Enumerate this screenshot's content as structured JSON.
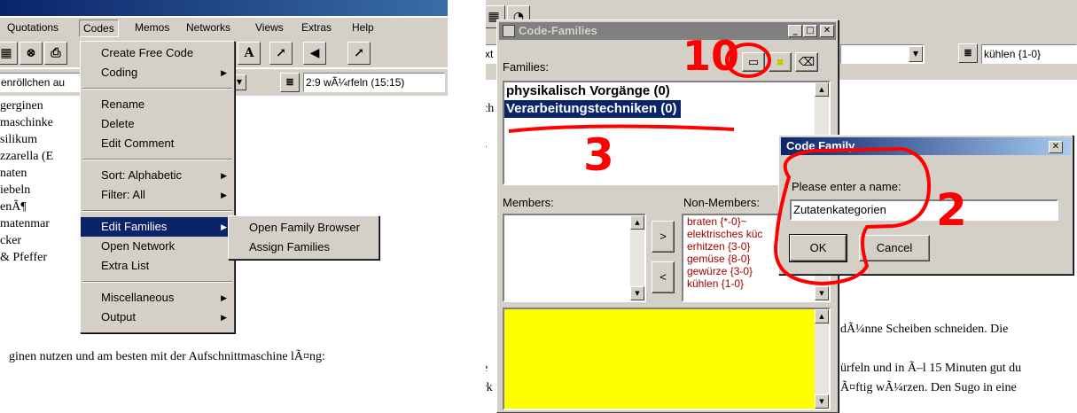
{
  "left_window": {
    "menubar": [
      "Quotations",
      "Codes",
      "Memos",
      "Networks",
      "Views",
      "Extras",
      "Help"
    ],
    "quotation_combo": "2:9 wÃ¼rfeln (15:15)",
    "doc_combo": "enröllchen au",
    "document_lines": [
      "gerginen",
      "maschinke",
      "silikum",
      "zzarella (E",
      "naten",
      "iebeln",
      "enÃ¶",
      "matenmar",
      "cker",
      "& Pfeffer"
    ],
    "document_bottom": "ginen nutzen und am besten mit der Aufschnittmaschine lÃ¤ng:",
    "codes_menu": {
      "items": [
        {
          "label": "Create Free Code"
        },
        {
          "label": "Coding",
          "submenu": true
        },
        {
          "label": "Rename"
        },
        {
          "label": "Delete"
        },
        {
          "label": "Edit Comment"
        },
        {
          "label": "Sort: Alphabetic",
          "submenu": true
        },
        {
          "label": "Filter: All",
          "submenu": true
        },
        {
          "label": "Edit Families",
          "submenu": true,
          "highlighted": true
        },
        {
          "label": "Open Network"
        },
        {
          "label": "Extra List"
        },
        {
          "label": "Miscellaneous",
          "submenu": true
        },
        {
          "label": "Output",
          "submenu": true
        }
      ]
    },
    "families_submenu": {
      "items": [
        "Open Family Browser",
        "Assign Families"
      ]
    }
  },
  "right_window": {
    "code_combo": "kühlen {1-0}",
    "doc_fragments": {
      "line1": "dÃ¼nne Scheiben schneiden. Die",
      "line2": "ürfeln und in Ã–l 15 Minuten gut du",
      "line3": "Ã¤ftig wÃ¼rzen. Den Sugo in eine",
      "frag_ch": "ch",
      "frag_r": "r",
      "frag_t": "t",
      "frag_e": "e",
      "frag_rk": "rk"
    },
    "code_families_dialog": {
      "title": "Code-Families",
      "families_label": "Families:",
      "families": [
        {
          "label": "physikalisch Vorgänge (0)",
          "selected": false
        },
        {
          "label": "Verarbeitungstechniken (0)",
          "selected": true
        }
      ],
      "members_label": "Members:",
      "non_members_label": "Non-Members:",
      "non_members": [
        "braten {*-0}~",
        "elektrisches küc",
        "erhitzen {3-0}",
        "gemüse {8-0}",
        "gewürze {3-0}",
        "kühlen {1-0}"
      ],
      "add_button": ">",
      "remove_button": "<",
      "comment_color": "#ffff00"
    },
    "code_family_dialog": {
      "title": "Code Family",
      "close": "✕",
      "prompt": "Please enter a name:",
      "name_value": "Zutatenkategorien",
      "ok": "OK",
      "cancel": "Cancel"
    },
    "annotations": {
      "a1": "10",
      "a2": "2",
      "a3": "3"
    }
  },
  "colors": {
    "annotation_red": "#ff0000",
    "selection_blue": "#0a246a",
    "face": "#d4d0c8"
  }
}
